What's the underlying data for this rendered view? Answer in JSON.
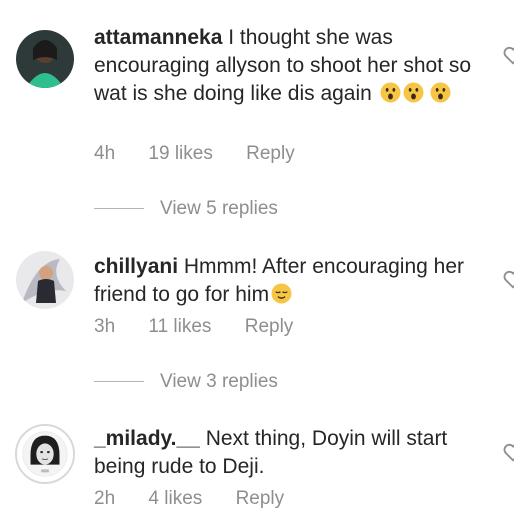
{
  "comments": [
    {
      "username": "attamanneka",
      "text": "I thought she was encouraging allyson to shoot her shot so wat is she doing like dis again",
      "emojis": [
        "astonished-face-icon",
        "astonished-face-icon",
        "astonished-face-icon"
      ],
      "time": "4h",
      "likes": "19 likes",
      "reply": "Reply",
      "view_replies": "View 5 replies"
    },
    {
      "username": "chillyani",
      "text": "Hmmm! After encouraging her friend to go for him",
      "emojis": [
        "relieved-face-icon"
      ],
      "time": "3h",
      "likes": "11 likes",
      "reply": "Reply",
      "view_replies": "View 3 replies"
    },
    {
      "username": "_milady.__",
      "text": "Next thing, Doyin will start being rude to Deji.",
      "emojis": [],
      "time": "2h",
      "likes": "4 likes",
      "reply": "Reply"
    }
  ],
  "colors": {
    "text": "#262626",
    "meta": "#8e8e8e",
    "story_ring": "#d8d8d8",
    "emoji_yellow": "#f7c544"
  }
}
